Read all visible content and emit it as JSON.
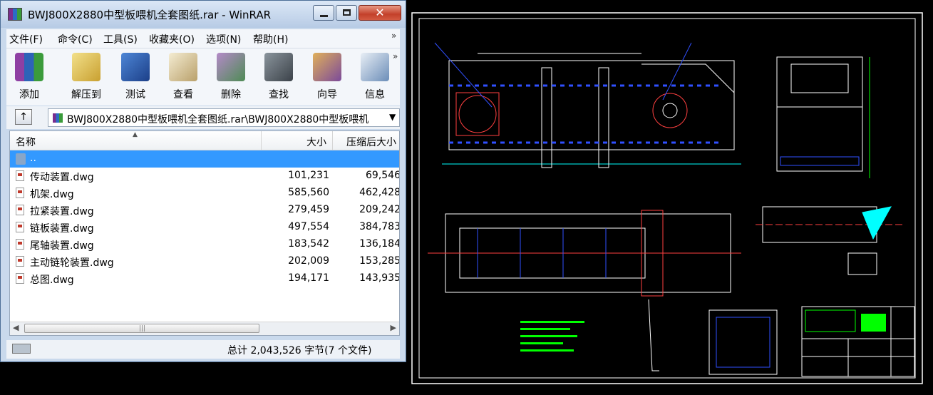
{
  "window": {
    "title": "BWJ800X2880中型板喂机全套图纸.rar - WinRAR",
    "controls": {
      "minimize": "",
      "maximize": "",
      "close": "✕"
    }
  },
  "menu": [
    "文件(F)",
    "命令(C)",
    "工具(S)",
    "收藏夹(O)",
    "选项(N)",
    "帮助(H)"
  ],
  "toolbar": [
    {
      "label": "添加",
      "icon": "add-archive-icon",
      "color": "#8e3fa3"
    },
    {
      "label": "解压到",
      "icon": "extract-to-icon",
      "color": "#d9b23a"
    },
    {
      "label": "测试",
      "icon": "test-icon",
      "color": "#2d63b8"
    },
    {
      "label": "查看",
      "icon": "view-icon",
      "color": "#c9b27a"
    },
    {
      "label": "删除",
      "icon": "delete-icon",
      "color": "#8a5fa6"
    },
    {
      "label": "查找",
      "icon": "find-icon",
      "color": "#555e66"
    },
    {
      "label": "向导",
      "icon": "wizard-icon",
      "color": "#c98a2a"
    },
    {
      "label": "信息",
      "icon": "info-icon",
      "color": "#3a7fc4"
    }
  ],
  "address": {
    "up_glyph": "↑",
    "path": "BWJ800X2880中型板喂机全套图纸.rar\\BWJ800X2880中型板喂机",
    "dropdown": "▼"
  },
  "columns": {
    "name": "名称",
    "size": "大小",
    "packed": "压缩后大小"
  },
  "files": [
    {
      "name": "..",
      "size": "",
      "packed": "",
      "type": "folder",
      "selected": true
    },
    {
      "name": "传动装置.dwg",
      "size": "101,231",
      "packed": "69,546",
      "type": "dwg"
    },
    {
      "name": "机架.dwg",
      "size": "585,560",
      "packed": "462,428",
      "type": "dwg"
    },
    {
      "name": "拉紧装置.dwg",
      "size": "279,459",
      "packed": "209,242",
      "type": "dwg"
    },
    {
      "name": "链板装置.dwg",
      "size": "497,554",
      "packed": "384,783",
      "type": "dwg"
    },
    {
      "name": "尾轴装置.dwg",
      "size": "183,542",
      "packed": "136,184",
      "type": "dwg"
    },
    {
      "name": "主动链轮装置.dwg",
      "size": "202,009",
      "packed": "153,285",
      "type": "dwg"
    },
    {
      "name": "总图.dwg",
      "size": "194,171",
      "packed": "143,935",
      "type": "dwg"
    }
  ],
  "scrollbar": {
    "left": "◀",
    "right": "▶",
    "grip": "|||"
  },
  "status": {
    "text": "总计 2,043,526 字节(7 个文件)"
  },
  "colors": {
    "cad_line": "#ffffff",
    "cad_red": "#ff3030",
    "cad_blue": "#3050ff",
    "cad_cyan": "#00ffff",
    "cad_green": "#00ff00",
    "cad_yellow": "#ffff00",
    "cad_magenta": "#ff40ff"
  }
}
